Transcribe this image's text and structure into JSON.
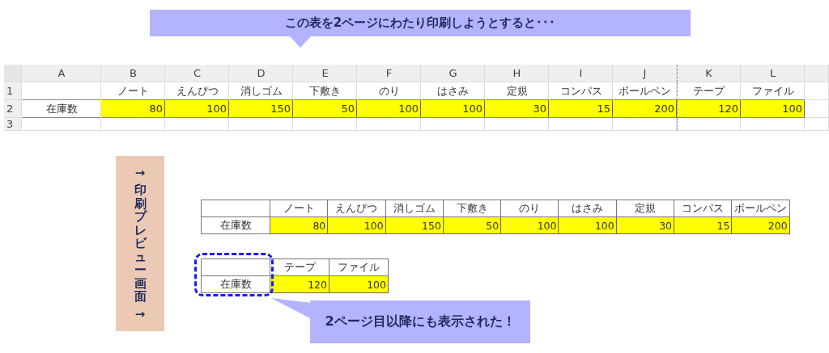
{
  "banner": {
    "text": "この表を2ページにわたり印刷しようとすると･･･"
  },
  "sheet": {
    "column_headers": [
      "A",
      "B",
      "C",
      "D",
      "E",
      "F",
      "G",
      "H",
      "I",
      "J",
      "K",
      "L"
    ],
    "row_numbers": [
      "1",
      "2",
      "3"
    ],
    "row_label": "在庫数",
    "items": [
      {
        "name": "ノート",
        "stock": "80",
        "page_break_before": false
      },
      {
        "name": "えんぴつ",
        "stock": "100",
        "page_break_before": false
      },
      {
        "name": "消しゴム",
        "stock": "150",
        "page_break_before": false
      },
      {
        "name": "下敷き",
        "stock": "50",
        "page_break_before": false
      },
      {
        "name": "のり",
        "stock": "100",
        "page_break_before": false
      },
      {
        "name": "はさみ",
        "stock": "100",
        "page_break_before": false
      },
      {
        "name": "定規",
        "stock": "30",
        "page_break_before": false
      },
      {
        "name": "コンパス",
        "stock": "15",
        "page_break_before": false
      },
      {
        "name": "ボールペン",
        "stock": "200",
        "page_break_before": false
      },
      {
        "name": "テープ",
        "stock": "120",
        "page_break_before": true
      },
      {
        "name": "ファイル",
        "stock": "100",
        "page_break_before": false
      }
    ]
  },
  "preview_label": {
    "arrow_top": "→",
    "text": "印刷プレビュー画面",
    "arrow_bottom": "→"
  },
  "preview_pages": [
    {
      "row_label": "在庫数",
      "highlighted": false,
      "items": [
        {
          "name": "ノート",
          "stock": "80"
        },
        {
          "name": "えんぴつ",
          "stock": "100"
        },
        {
          "name": "消しゴム",
          "stock": "150"
        },
        {
          "name": "下敷き",
          "stock": "50"
        },
        {
          "name": "のり",
          "stock": "100"
        },
        {
          "name": "はさみ",
          "stock": "100"
        },
        {
          "name": "定規",
          "stock": "30"
        },
        {
          "name": "コンパス",
          "stock": "15"
        },
        {
          "name": "ボールペン",
          "stock": "200"
        }
      ]
    },
    {
      "row_label": "在庫数",
      "highlighted": true,
      "items": [
        {
          "name": "テープ",
          "stock": "120"
        },
        {
          "name": "ファイル",
          "stock": "100"
        }
      ]
    }
  ],
  "callout": {
    "text": "2ページ目以降にも表示された！"
  }
}
